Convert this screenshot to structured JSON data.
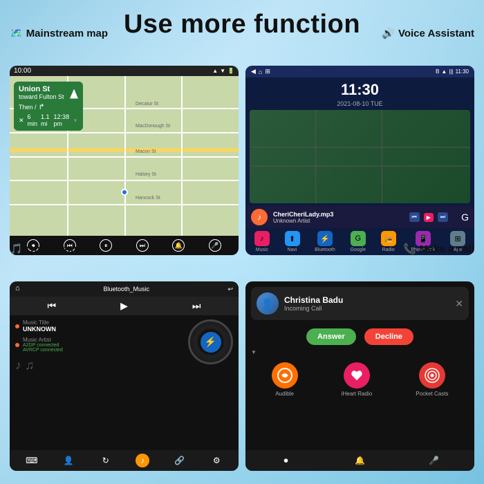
{
  "page": {
    "title": "Use more function",
    "background": "#a8d8ea"
  },
  "panel_mainstream_map": {
    "label": "Mainstream map",
    "icon": "🎵",
    "time": "10:00",
    "street_name": "Union St",
    "toward": "toward Fulton St",
    "then_text": "Then /",
    "time_value": "6 min",
    "distance": "1.1 mi",
    "arrive_time": "12:38 pm"
  },
  "panel_voice_assistant": {
    "label": "Voice Assistant",
    "icon": "🔊",
    "time": "11:30",
    "date": "2021-08-10  TUE",
    "music_title": "CheriCheriLady.mp3",
    "music_artist": "Unknown Artist",
    "apps": [
      {
        "name": "Music",
        "color": "#e91e63"
      },
      {
        "name": "Navi",
        "color": "#2196F3"
      },
      {
        "name": "Bluetooth",
        "color": "#1565C0"
      },
      {
        "name": "Google",
        "color": "#4CAF50"
      },
      {
        "name": "Radio",
        "color": "#FF9800"
      },
      {
        "name": "Phone Link",
        "color": "#9C27B0"
      },
      {
        "name": "App",
        "color": "#607D8B"
      }
    ]
  },
  "panel_online_music": {
    "label": "Online music",
    "icon": "🎵",
    "source": "Bluetooth_Music",
    "music_title_label": "Music Title",
    "music_title_value": "UNKNOWN",
    "music_artist_label": "Music Artist",
    "connection1": "A2DP connected",
    "connection2": "AVRCP connected"
  },
  "panel_make_call": {
    "label": "Make a call",
    "icon": "📞",
    "caller_name": "Christina Badu",
    "call_status": "Incoming Call",
    "answer_label": "Answer",
    "decline_label": "Decline",
    "apps": [
      {
        "name": "Audible",
        "color": "#FF6F00"
      },
      {
        "name": "iHeart Radio",
        "color": "#E91E63"
      },
      {
        "name": "Pocket Casts",
        "color": "#E53935"
      }
    ]
  }
}
